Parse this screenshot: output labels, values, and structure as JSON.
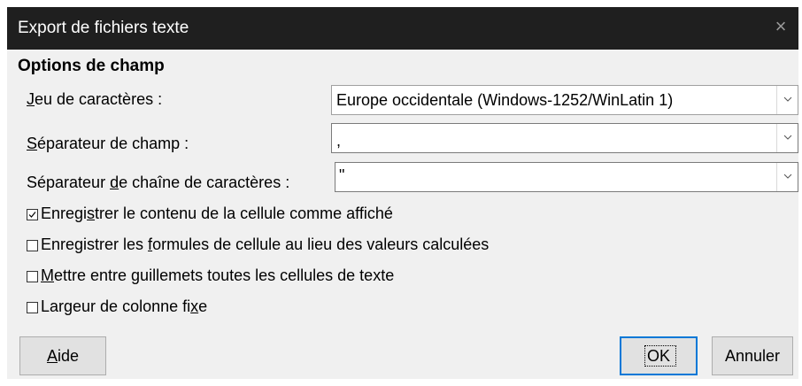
{
  "window": {
    "title": "Export de fichiers texte",
    "close_glyph": "×"
  },
  "section": {
    "title": "Options de champ"
  },
  "fields": {
    "charset": {
      "label_pre": "",
      "label_key": "J",
      "label_post": "eu de caractères :",
      "value": "Europe occidentale (Windows-1252/WinLatin 1)"
    },
    "field_sep": {
      "label_pre": "",
      "label_key": "S",
      "label_post": "éparateur de champ :",
      "value": ","
    },
    "string_sep": {
      "label_pre": "Séparateur ",
      "label_key": "d",
      "label_post": "e chaîne de caractères :",
      "value": "\""
    }
  },
  "checkboxes": [
    {
      "pre": "Enregi",
      "key": "s",
      "post": "trer le contenu de la cellule comme affiché",
      "checked": true
    },
    {
      "pre": "Enregistrer les ",
      "key": "f",
      "post": "ormules de cellule au lieu des valeurs calculées",
      "checked": false
    },
    {
      "pre": "",
      "key": "M",
      "post": "ettre entre guillemets toutes les cellules de texte",
      "checked": false
    },
    {
      "pre": "Largeur de colonne fi",
      "key": "x",
      "post": "e",
      "checked": false
    }
  ],
  "buttons": {
    "help_key": "A",
    "help_rest": "ide",
    "ok_label": "OK",
    "cancel_label": "Annuler"
  },
  "icons": {
    "close": "close-icon",
    "dropdown": "chevron-down-icon",
    "check": "checkmark-icon"
  },
  "colors": {
    "titlebar_bg": "#1f1f1f",
    "dialog_bg": "#f0f0f0",
    "accent": "#0078d7"
  }
}
